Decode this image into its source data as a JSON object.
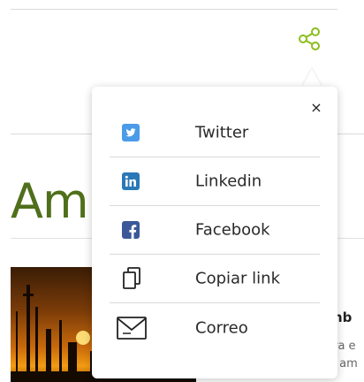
{
  "article": {
    "heading": "Am",
    "side_title": "mb",
    "side_line1": "tra e",
    "side_line2": "e am"
  },
  "share_menu": {
    "close_label": "×",
    "items": [
      {
        "label": "Twitter",
        "icon": "twitter-icon"
      },
      {
        "label": "Linkedin",
        "icon": "linkedin-icon"
      },
      {
        "label": "Facebook",
        "icon": "facebook-icon"
      },
      {
        "label": "Copiar link",
        "icon": "copy-link-icon"
      },
      {
        "label": "Correo",
        "icon": "mail-icon"
      }
    ]
  },
  "colors": {
    "accent_green": "#8bbd1d",
    "heading_green": "#4f6f1a",
    "twitter_blue": "#4a9be8",
    "linkedin_blue": "#2b78b7",
    "facebook_blue": "#3b5998"
  }
}
